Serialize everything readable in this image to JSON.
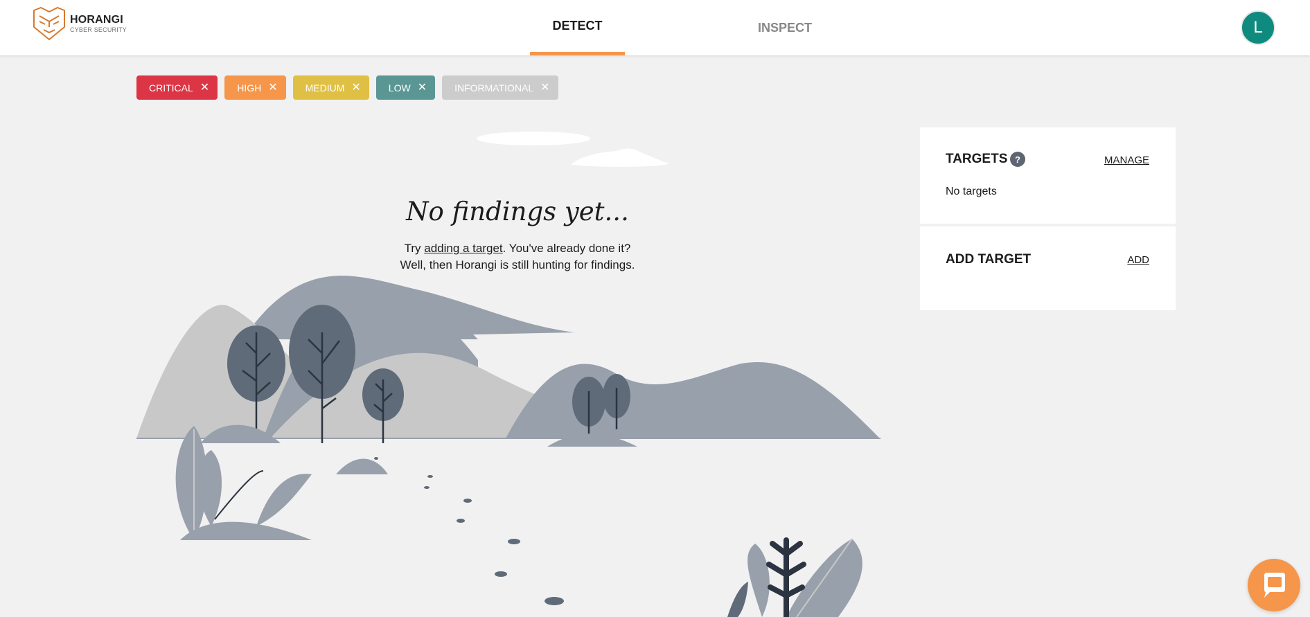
{
  "header": {
    "logo": {
      "name": "HORANGI",
      "subtitle": "CYBER SECURITY"
    },
    "tabs": [
      {
        "label": "DETECT",
        "active": true
      },
      {
        "label": "INSPECT",
        "active": false
      }
    ],
    "avatar_initial": "L",
    "colors": {
      "active_tab_underline": "#f5964b",
      "avatar": "#0e8a7e"
    }
  },
  "filters": [
    {
      "label": "CRITICAL",
      "color": "#dc3545"
    },
    {
      "label": "HIGH",
      "color": "#f5964b"
    },
    {
      "label": "MEDIUM",
      "color": "#e0c044"
    },
    {
      "label": "LOW",
      "color": "#5a9794"
    },
    {
      "label": "INFORMATIONAL",
      "color": "#cccccc"
    }
  ],
  "chip_close_glyph": "✕",
  "empty_state": {
    "title": "No findings yet...",
    "line1_prefix": "Try ",
    "line1_link": "adding a target",
    "line1_suffix": ". You've already done it?",
    "line2": "Well, then Horangi is still hunting for findings."
  },
  "targets_panel": {
    "title": "TARGETS",
    "help": "?",
    "manage_label": "MANAGE",
    "empty_text": "No targets"
  },
  "add_target_panel": {
    "title": "ADD TARGET",
    "add_label": "ADD"
  },
  "chat": {
    "icon": "chat-bubble-icon",
    "color": "#f5964b"
  }
}
